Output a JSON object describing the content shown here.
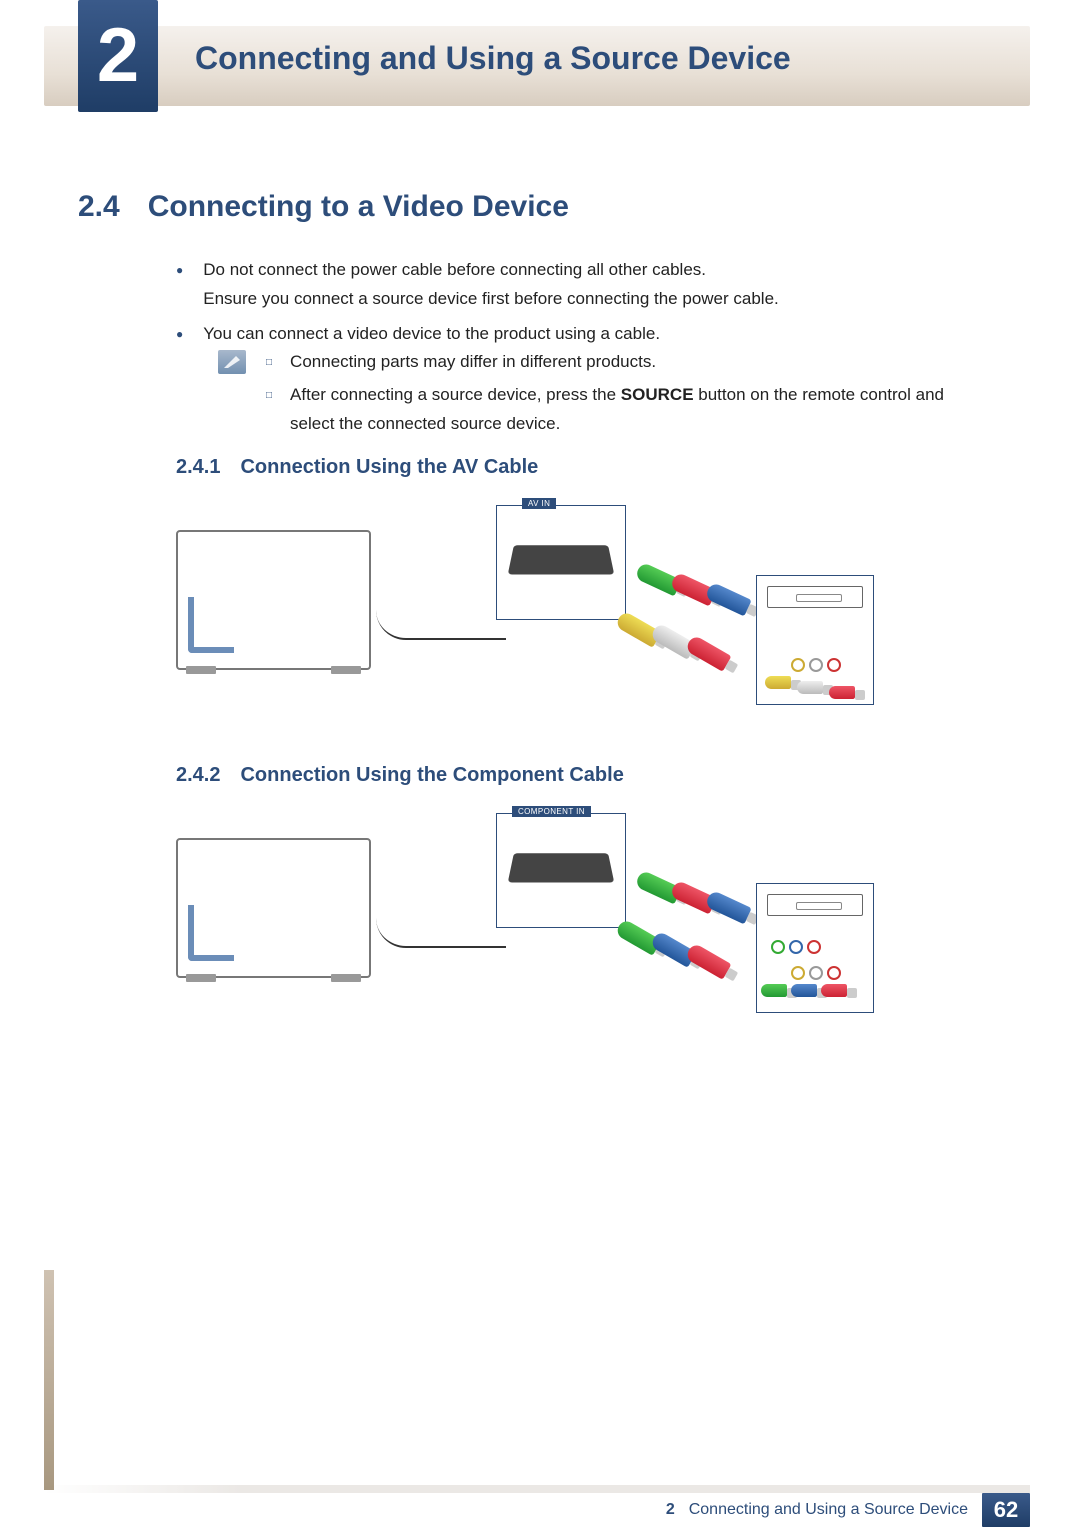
{
  "header": {
    "chapter_number": "2",
    "chapter_title": "Connecting and Using a Source Device"
  },
  "section": {
    "number": "2.4",
    "title": "Connecting to a Video Device"
  },
  "bullets": [
    "Do not connect the power cable before connecting all other cables.\nEnsure you connect a source device first before connecting the power cable.",
    "You can connect a video device to the product using a cable."
  ],
  "notes": {
    "items": [
      "Connecting parts may differ in different products.",
      "After connecting a source device, press the SOURCE button on the remote control and select the connected source device."
    ],
    "source_label": "SOURCE"
  },
  "subsection1": {
    "number": "2.4.1",
    "title": "Connection Using the AV Cable",
    "port_label": "AV IN"
  },
  "subsection2": {
    "number": "2.4.2",
    "title": "Connection Using the Component Cable",
    "port_label": "COMPONENT IN"
  },
  "footer": {
    "chapter_number": "2",
    "chapter_title": "Connecting and Using a Source Device",
    "page": "62"
  }
}
